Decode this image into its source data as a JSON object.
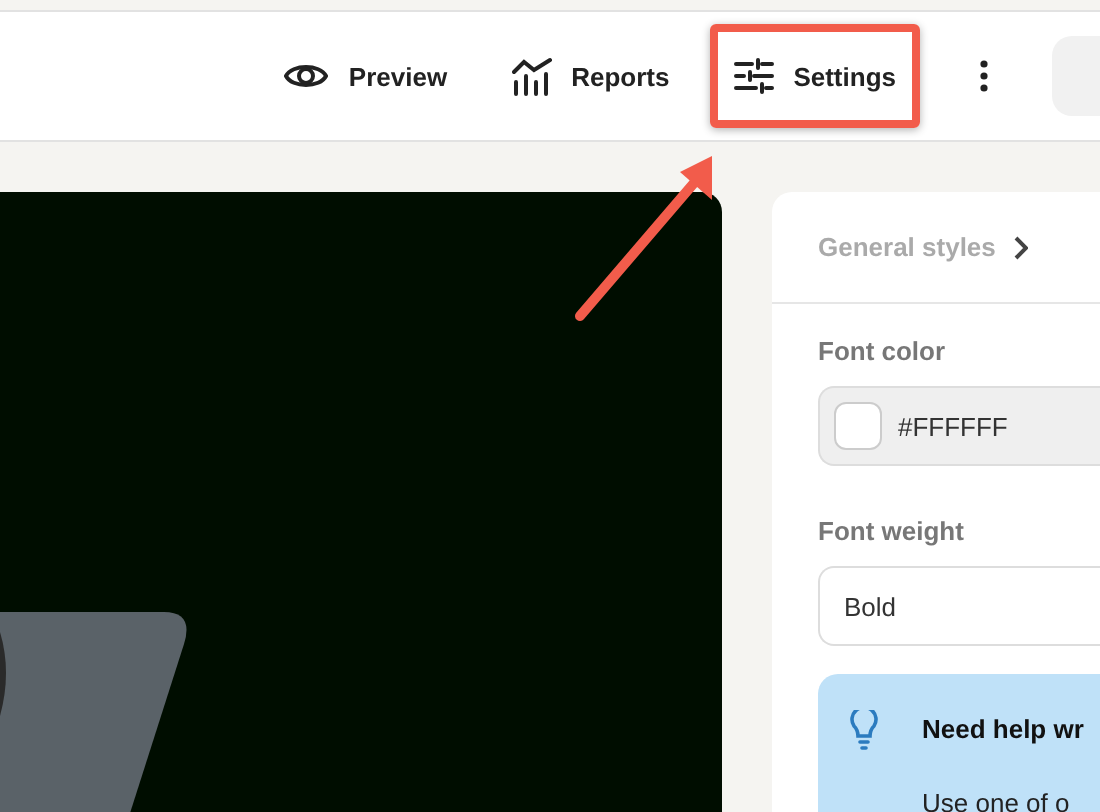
{
  "toolbar": {
    "items": [
      {
        "kind": "eye",
        "label": "Preview",
        "selected": false
      },
      {
        "kind": "chart",
        "label": "Reports",
        "selected": false
      },
      {
        "kind": "sliders",
        "label": "Settings",
        "selected": true
      }
    ]
  },
  "side_panel": {
    "breadcrumb": "General styles",
    "fields": [
      {
        "kind": "color",
        "label": "Font color",
        "value": "#FFFFFF"
      },
      {
        "kind": "select",
        "label": "Font weight",
        "value": "Bold"
      }
    ],
    "help": {
      "title": "Need help wr",
      "text": "Use one of o"
    }
  }
}
